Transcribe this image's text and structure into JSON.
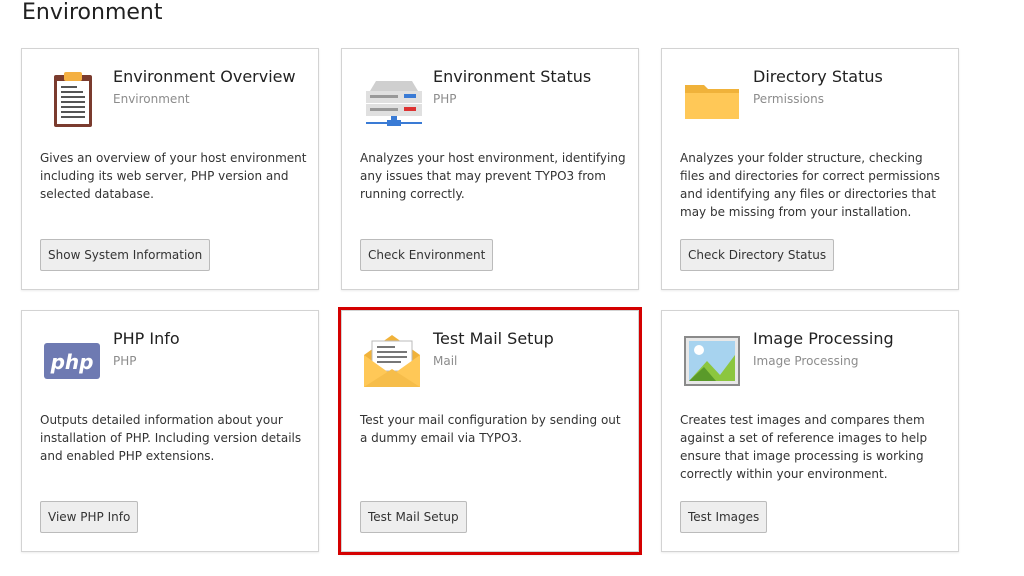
{
  "page": {
    "title": "Environment"
  },
  "cards": [
    {
      "title": "Environment Overview",
      "subtitle": "Environment",
      "description": "Gives an overview of your host environment including its web server, PHP version and selected database.",
      "button": "Show System Information",
      "icon": "clipboard-icon"
    },
    {
      "title": "Environment Status",
      "subtitle": "PHP",
      "description": "Analyzes your host environment, identifying any issues that may prevent TYPO3 from running correctly.",
      "button": "Check Environment",
      "icon": "server-icon"
    },
    {
      "title": "Directory Status",
      "subtitle": "Permissions",
      "description": "Analyzes your folder structure, checking files and directories for correct permissions and identifying any files or directories that may be missing from your installation.",
      "button": "Check Directory Status",
      "icon": "folder-icon"
    },
    {
      "title": "PHP Info",
      "subtitle": "PHP",
      "description": "Outputs detailed information about your installation of PHP. Including version details and enabled PHP extensions.",
      "button": "View PHP Info",
      "icon": "php-logo-icon",
      "icon_text": "php"
    },
    {
      "title": "Test Mail Setup",
      "subtitle": "Mail",
      "description": "Test your mail configuration by sending out a dummy email via TYPO3.",
      "button": "Test Mail Setup",
      "icon": "envelope-icon"
    },
    {
      "title": "Image Processing",
      "subtitle": "Image Processing",
      "description": "Creates test images and compares them against a set of reference images to help ensure that image processing is working correctly within your environment.",
      "button": "Test Images",
      "icon": "image-icon"
    }
  ],
  "colors": {
    "highlight": "#d40000",
    "folder": "#ffc857",
    "php": "#6e7ab2",
    "clipboard": "#7a3b2e"
  }
}
